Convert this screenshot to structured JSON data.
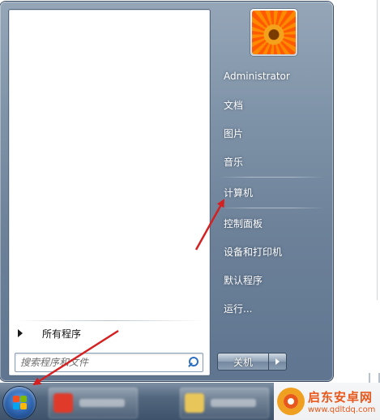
{
  "start_menu": {
    "all_programs_label": "所有程序",
    "search_placeholder": "搜索程序和文件",
    "user_name": "Administrator",
    "right_items": [
      "文档",
      "图片",
      "音乐",
      "计算机",
      "控制面板",
      "设备和打印机",
      "默认程序",
      "运行..."
    ],
    "shutdown_label": "关机"
  },
  "taskbar": {
    "start_button_icon": "windows-logo-icon"
  },
  "watermark": {
    "title": "启东安卓网",
    "url": "www.qdltdq.com"
  },
  "annotation_color": "#d42020"
}
